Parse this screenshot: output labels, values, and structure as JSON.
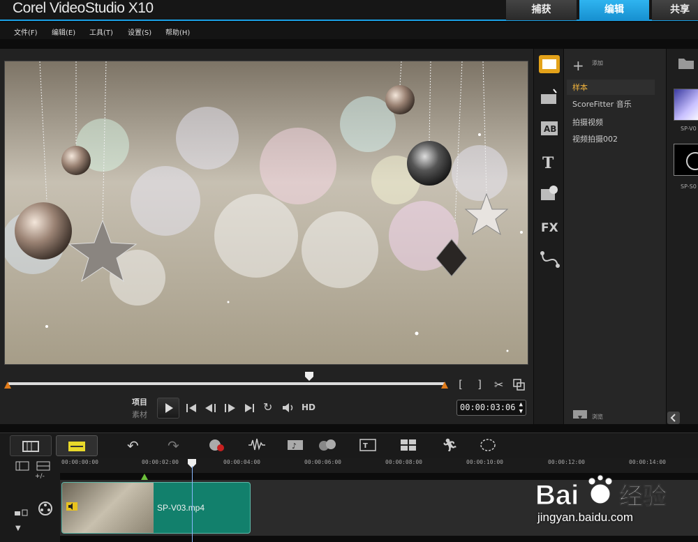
{
  "app": {
    "title": "Corel VideoStudio X10"
  },
  "mode_tabs": {
    "capture": "捕获",
    "edit": "编辑",
    "share": "共享"
  },
  "menu": [
    "文件(F)",
    "编辑(E)",
    "工具(T)",
    "设置(S)",
    "帮助(H)"
  ],
  "player": {
    "mode_project": "项目",
    "mode_clip": "素材",
    "hd": "HD",
    "timecode": "00:00:03:06",
    "bracket_in": "[",
    "bracket_out": "]"
  },
  "library": {
    "add_label": "添加",
    "items": [
      "样本",
      "ScoreFitter 音乐",
      "拍摄视频",
      "视频拍摄002"
    ],
    "browse_label": "浏览",
    "thumb_labels": [
      "SP-V0",
      "SP-S0"
    ]
  },
  "timeline": {
    "ruler": [
      "00:00:00:00",
      "00:00:02:00",
      "00:00:04:00",
      "00:00:06:00",
      "00:00:08:00",
      "00:00:10:00",
      "00:00:12:00",
      "00:00:14:00"
    ],
    "clip_name": "SP-V03.mp4",
    "zoom_label": "+/-"
  },
  "watermark": {
    "brand": "Bai du 经验",
    "url": "jingyan.baidu.com"
  },
  "colors": {
    "accent": "#1aa0e6",
    "clip": "#12806c",
    "selected": "#f0b23c"
  }
}
